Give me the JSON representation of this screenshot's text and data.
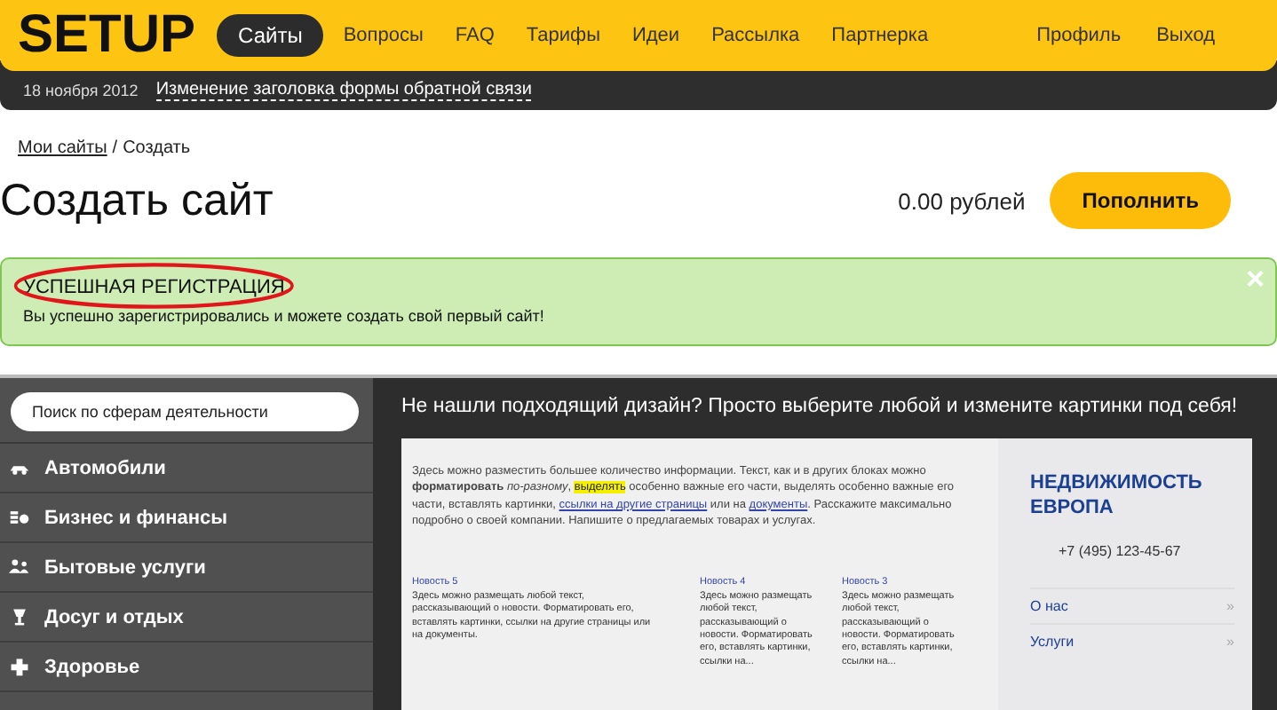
{
  "header": {
    "logo": "SETUP",
    "nav": [
      {
        "label": "Сайты",
        "selected": true
      },
      {
        "label": "Вопросы",
        "selected": false
      },
      {
        "label": "FAQ",
        "selected": false
      },
      {
        "label": "Тарифы",
        "selected": false
      },
      {
        "label": "Идеи",
        "selected": false
      },
      {
        "label": "Рассылка",
        "selected": false
      },
      {
        "label": "Партнерка",
        "selected": false
      }
    ],
    "user_links": [
      "Профиль",
      "Выход"
    ]
  },
  "news_bar": {
    "date": "18 ноября 2012",
    "headline": "Изменение заголовка формы обратной связи"
  },
  "breadcrumb": {
    "link": "Мои сайты",
    "separator": "/",
    "current": "Создать"
  },
  "page": {
    "title": "Создать сайт",
    "balance": "0.00 рублей",
    "topup_button": "Пополнить"
  },
  "alert": {
    "title": "УСПЕШНАЯ РЕГИСТРАЦИЯ",
    "message": "Вы успешно зарегистрировались и можете создать свой первый сайт!",
    "close": "×",
    "title_circled": true
  },
  "sidebar": {
    "search": {
      "placeholder": "Поиск по сферам деятельности"
    },
    "items": [
      {
        "label": "Автомобили",
        "kind": "car"
      },
      {
        "label": "Бизнес и финансы",
        "kind": "money"
      },
      {
        "label": "Бытовые услуги",
        "kind": "people"
      },
      {
        "label": "Досуг и отдых",
        "kind": "cup"
      },
      {
        "label": "Здоровье",
        "kind": "cross"
      }
    ]
  },
  "design_panel": {
    "heading": "Не нашли подходящий дизайн? Просто выберите любой и измените картинки под себя!",
    "preview": {
      "intro": [
        {
          "kind": "plain",
          "text": "Здесь можно разместить большее количество информации. Текст, как и в других блоках можно "
        },
        {
          "kind": "bold",
          "text": "форматировать "
        },
        {
          "kind": "italic",
          "text": "по-разному"
        },
        {
          "kind": "plain",
          "text": ", "
        },
        {
          "kind": "mark",
          "text": "выделять"
        },
        {
          "kind": "plain",
          "text": " особенно важные его части, выделять особенно важные его части, вставлять картинки, "
        },
        {
          "kind": "link",
          "text": "ссылки на другие страницы"
        },
        {
          "kind": "plain",
          "text": " или на "
        },
        {
          "kind": "link",
          "text": "документы"
        },
        {
          "kind": "plain",
          "text": ". Расскажите максимально подробно о своей компании. Напишите о предлагаемых товарах и услугах."
        }
      ],
      "news": [
        {
          "title": "Новость 5",
          "text": "Здесь можно размещать любой текст, рассказывающий о новости. Форматировать его, вставлять картинки, ссылки на другие страницы или на документы."
        },
        {
          "title": "Новость 4",
          "text": "Здесь можно размещать любой текст, рассказывающий о новости. Форматировать его, вставлять картинки, ссылки на..."
        },
        {
          "title": "Новость 3",
          "text": "Здесь можно размещать любой текст, рассказывающий о новости. Форматировать его, вставлять картинки, ссылки на..."
        }
      ],
      "company": "НЕДВИЖИМОСТЬ ЕВРОПА",
      "phone": "+7 (495) 123-45-67",
      "menu": [
        {
          "label": "О нас",
          "arrow": "»"
        },
        {
          "label": "Услуги",
          "arrow": "»"
        }
      ]
    }
  }
}
